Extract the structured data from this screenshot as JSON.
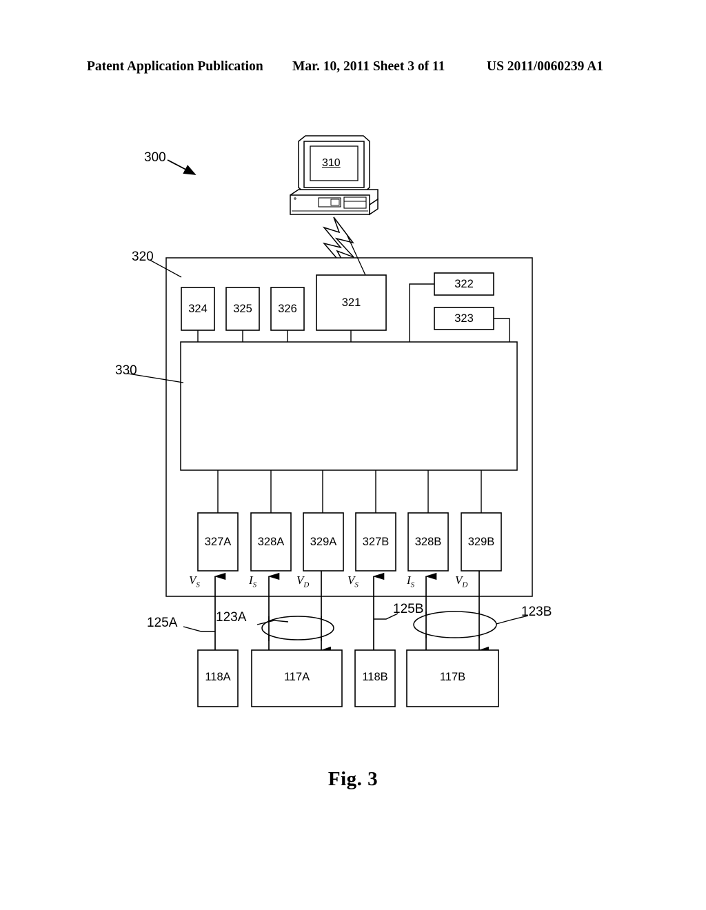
{
  "header": {
    "left": "Patent Application Publication",
    "middle": "Mar. 10, 2011  Sheet 3 of 11",
    "right": "US 2011/0060239 A1"
  },
  "figure": {
    "caption": "Fig. 3",
    "system_ref": "300",
    "computer_ref": "310",
    "enclosure_ref": "320",
    "controller_ref": "330",
    "top_blocks": [
      {
        "label": "324"
      },
      {
        "label": "325"
      },
      {
        "label": "326"
      },
      {
        "label": "321"
      }
    ],
    "side_blocks": [
      {
        "label": "322"
      },
      {
        "label": "323"
      }
    ],
    "channel_blocks": [
      {
        "label": "327A",
        "signal": "V",
        "subscript": "S"
      },
      {
        "label": "328A",
        "signal": "I",
        "subscript": "S"
      },
      {
        "label": "329A",
        "signal": "V",
        "subscript": "D"
      },
      {
        "label": "327B",
        "signal": "V",
        "subscript": "S"
      },
      {
        "label": "328B",
        "signal": "I",
        "subscript": "S"
      },
      {
        "label": "329B",
        "signal": "V",
        "subscript": "D"
      }
    ],
    "device_blocks": [
      {
        "label": "118A"
      },
      {
        "label": "117A"
      },
      {
        "label": "118B"
      },
      {
        "label": "117B"
      }
    ],
    "lead_refs": [
      {
        "label": "125A"
      },
      {
        "label": "123A"
      },
      {
        "label": "125B"
      },
      {
        "label": "123B"
      }
    ]
  },
  "colors": {
    "ink": "#000000",
    "paper": "#ffffff"
  }
}
